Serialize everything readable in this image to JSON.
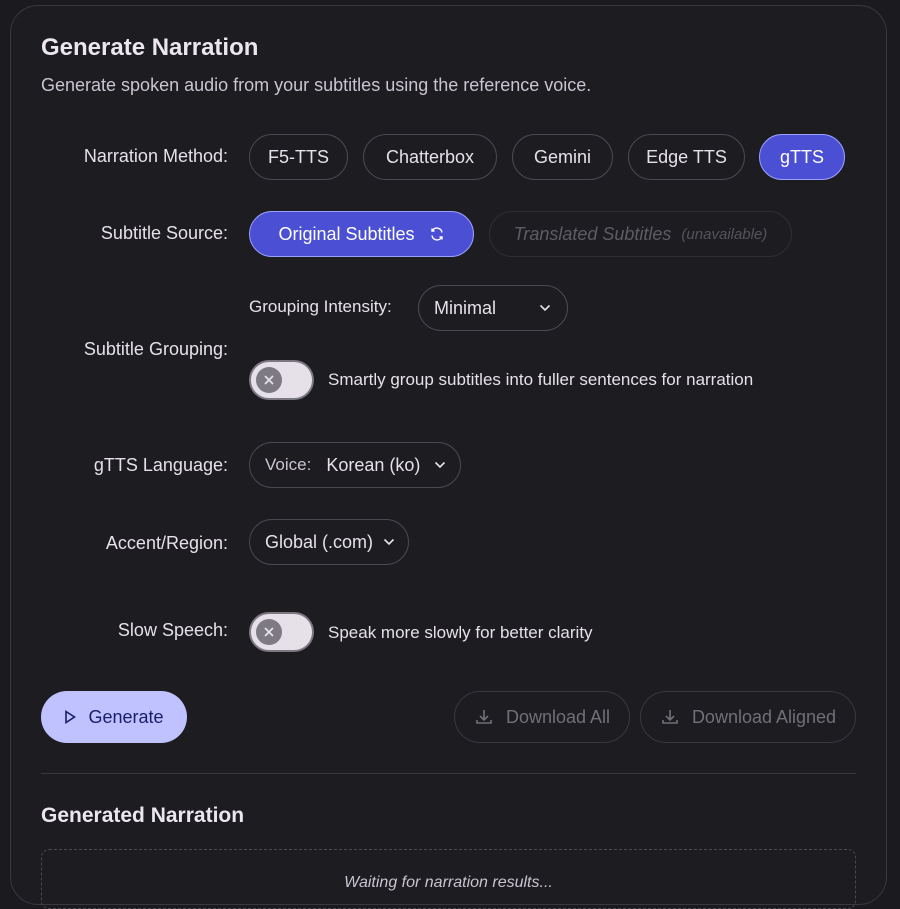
{
  "title": "Generate Narration",
  "subtitle": "Generate spoken audio from your subtitles using the reference voice.",
  "narration_method": {
    "label": "Narration Method:",
    "options": [
      "F5-TTS",
      "Chatterbox",
      "Gemini",
      "Edge TTS",
      "gTTS"
    ],
    "selected": "gTTS"
  },
  "subtitle_source": {
    "label": "Subtitle Source:",
    "original": "Original Subtitles",
    "translated": "Translated Subtitles",
    "translated_note": "(unavailable)"
  },
  "subtitle_grouping": {
    "label": "Subtitle Grouping:",
    "intensity_label": "Grouping Intensity:",
    "intensity_value": "Minimal",
    "toggle_text": "Smartly group subtitles into fuller sentences for narration",
    "enabled": false
  },
  "gtts_language": {
    "label": "gTTS Language:",
    "prefix": "Voice:",
    "value": "Korean (ko)"
  },
  "accent": {
    "label": "Accent/Region:",
    "value": "Global (.com)"
  },
  "slow_speech": {
    "label": "Slow Speech:",
    "toggle_text": "Speak more slowly for better clarity",
    "enabled": false
  },
  "actions": {
    "generate": "Generate",
    "download_all": "Download All",
    "download_aligned": "Download Aligned"
  },
  "results": {
    "title": "Generated Narration",
    "placeholder": "Waiting for narration results..."
  },
  "colors": {
    "accent": "#4a4fd3",
    "generate_bg": "#bfc2ff"
  }
}
